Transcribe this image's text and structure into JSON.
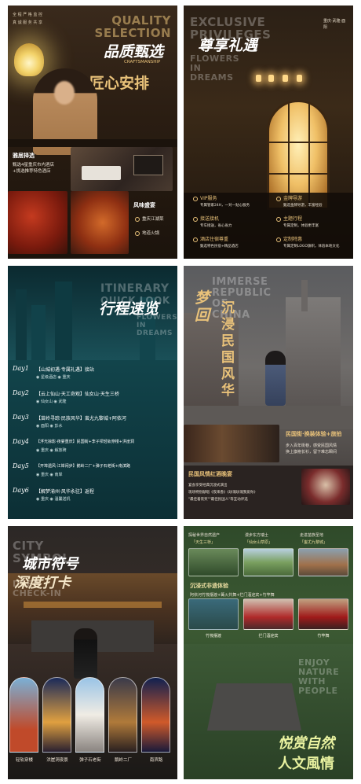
{
  "posters": [
    {
      "ghost_lines": [
        "QUALITY",
        "SELECTION"
      ],
      "side_lines": [
        "全 程 严 格 监 控",
        "真 诚 服 务 共 享"
      ],
      "headline": "品质甄选",
      "craft_text": "CRAFTSMANSHIP",
      "subheadline": "匠心安排",
      "hotel_label": "雅居择选",
      "hotel_desc": [
        "甄选4星重庆市内酒店",
        "+挑选推荐特色酒店"
      ],
      "food_label": "风味盛宴",
      "food_items": [
        "重庆江湖菜",
        "地道火锅"
      ]
    },
    {
      "ghost_lines": [
        "EXCLUSIVE",
        "PRIVILEGES",
        "FLOWERS",
        "IN",
        "DREAMS"
      ],
      "headline": "尊享礼遇",
      "side_text": "重庆·武隆·酉阳",
      "features": [
        {
          "title": "VIP服务",
          "desc": "专属管家24H，一对一贴心服务"
        },
        {
          "title": "金牌导游",
          "desc": "甄选金牌导游，丰富经验"
        },
        {
          "title": "接送接机",
          "desc": "专车接送，省心省力"
        },
        {
          "title": "主题行程",
          "desc": "专属定制，体验更丰富"
        },
        {
          "title": "酒店住宿尊重",
          "desc": "甄选特色民宿+精品酒店"
        },
        {
          "title": "定制特惠",
          "desc": "专属定制LOGO旗帜，体验本地文化"
        }
      ]
    },
    {
      "ghost_lines": [
        "ITINERARY",
        "QUICK LOOK",
        "FLOWERS",
        "IN",
        "DREAMS"
      ],
      "headline": "行程速览",
      "days": [
        {
          "day": "Day1",
          "title": "【山城初遇·专属礼遇】接站",
          "sub": "◉ 星级酒店   ◉ 重庆"
        },
        {
          "day": "Day2",
          "title": "【云上仙山·天工奇观】仙女山·天生三桥",
          "sub": "◉ 仙女山   ◉ 武隆"
        },
        {
          "day": "Day3",
          "title": "【苗岭寻踪·民族风华】蚩尤九黎城+阿依河",
          "sub": "◉ 酉阳   ◉ 彭水"
        },
        {
          "day": "Day4",
          "title": "【浮光掠影·夜宴重庆】民国街+李子坝轻轨穿楼+洪崖洞",
          "sub": "◉ 重庆   ◉ 解放碑"
        },
        {
          "day": "Day5",
          "title": "【开埠遗风·江岸闲步】鹅岭二厂+弹子石老街+南滨路",
          "sub": "◉ 重庆   ◉ 南岸"
        },
        {
          "day": "Day6",
          "title": "【解梦渝州·风华永驻】返程",
          "sub": "◉ 重庆   ◉ 温馨送机"
        }
      ]
    },
    {
      "ghost_lines": [
        "IMMERSE",
        "REPUBLIC",
        "OF",
        "CHINA"
      ],
      "headline_a": "梦回",
      "headline_b": "沉浸民国风华",
      "right_title": "民国街·换装体验+旅拍",
      "right_desc": [
        "步入百年街巷，感受民国风情",
        "换上旗袍长衫，留下难忘瞬间"
      ],
      "show_title": "民国风情红酒晚宴",
      "show_points": [
        "宴会享受经典沉浸式演出",
        "现场特别献唱《夜来香》《玫瑰玫瑰我爱你》",
        "\"最佳着装奖\"\"最佳民国人\"等互动评选"
      ]
    },
    {
      "ghost_lines": [
        "CITY",
        "SYMBOL",
        "DEEP",
        "CHECK-IN"
      ],
      "headline_a": "城市符号",
      "headline_b": "深度打卡",
      "spots": [
        "轻轨穿楼",
        "洪崖洞夜景",
        "弹子石老街",
        "鹅岭二厂",
        "南滨路"
      ]
    },
    {
      "ghost_lines": [
        "ENJOY",
        "NATURE",
        "WITH",
        "PEOPLE"
      ],
      "top_spots": [
        {
          "caption": "探秘世界自然遗产",
          "name": "「天生三桥」"
        },
        {
          "caption": "漫步东方瑞士",
          "name": "「仙女山草原」"
        },
        {
          "caption": "走进苗族圣地",
          "name": "「蚩尤九黎城」"
        }
      ],
      "section_title": "沉浸式非遗体验",
      "section_desc": "阿依河竹筏摆渡+篝火共舞+拦门酒迎宾+竹竿舞",
      "mid_spots": [
        "竹筏摆渡",
        "拦门酒迎宾",
        "竹竿舞"
      ],
      "headline_a": "悦赏自然",
      "headline_b": "人文風情"
    }
  ]
}
